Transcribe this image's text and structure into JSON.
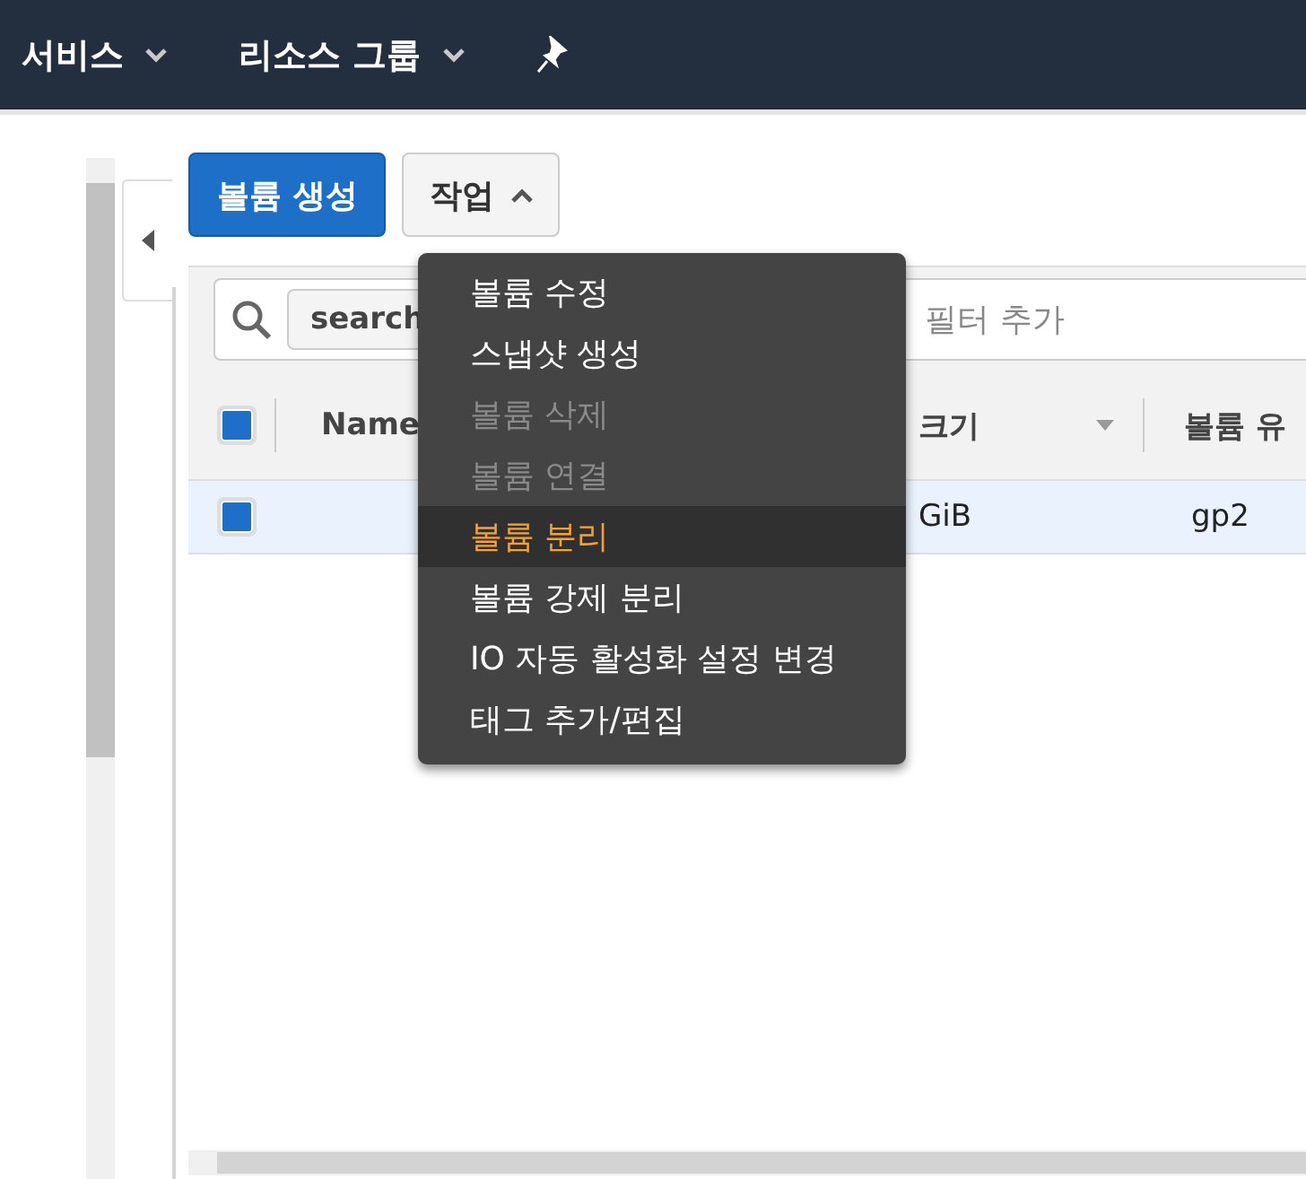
{
  "nav": {
    "items": [
      {
        "label": "서비스"
      },
      {
        "label": "리소스 그룹"
      }
    ]
  },
  "toolbar": {
    "create_button": "볼륨 생성",
    "actions_button": {
      "label": "작업",
      "expanded": true
    }
  },
  "filter": {
    "chip": "search",
    "placeholder": "필터 추가"
  },
  "table": {
    "select_all": {
      "checked": true
    },
    "columns": [
      {
        "label": "Name"
      },
      {
        "label": "크기",
        "sortable": true
      },
      {
        "label": "볼륨 유"
      }
    ],
    "rows": [
      {
        "checked": true,
        "selected": true,
        "cells": [
          "",
          "GiB",
          "gp2"
        ]
      }
    ]
  },
  "menu": {
    "items": [
      {
        "label": "볼륨 수정",
        "disabled": false,
        "selected": false
      },
      {
        "label": "스냅샷 생성",
        "disabled": false,
        "selected": false
      },
      {
        "label": "볼륨 삭제",
        "disabled": true,
        "selected": false
      },
      {
        "label": "볼륨 연결",
        "disabled": true,
        "selected": false
      },
      {
        "label": "볼륨 분리",
        "disabled": false,
        "selected": true
      },
      {
        "label": "볼륨 강제 분리",
        "disabled": false,
        "selected": false
      },
      {
        "label": "IO 자동 활성화 설정 변경",
        "disabled": false,
        "selected": false
      },
      {
        "label": "태그 추가/편집",
        "disabled": false,
        "selected": false
      }
    ]
  }
}
